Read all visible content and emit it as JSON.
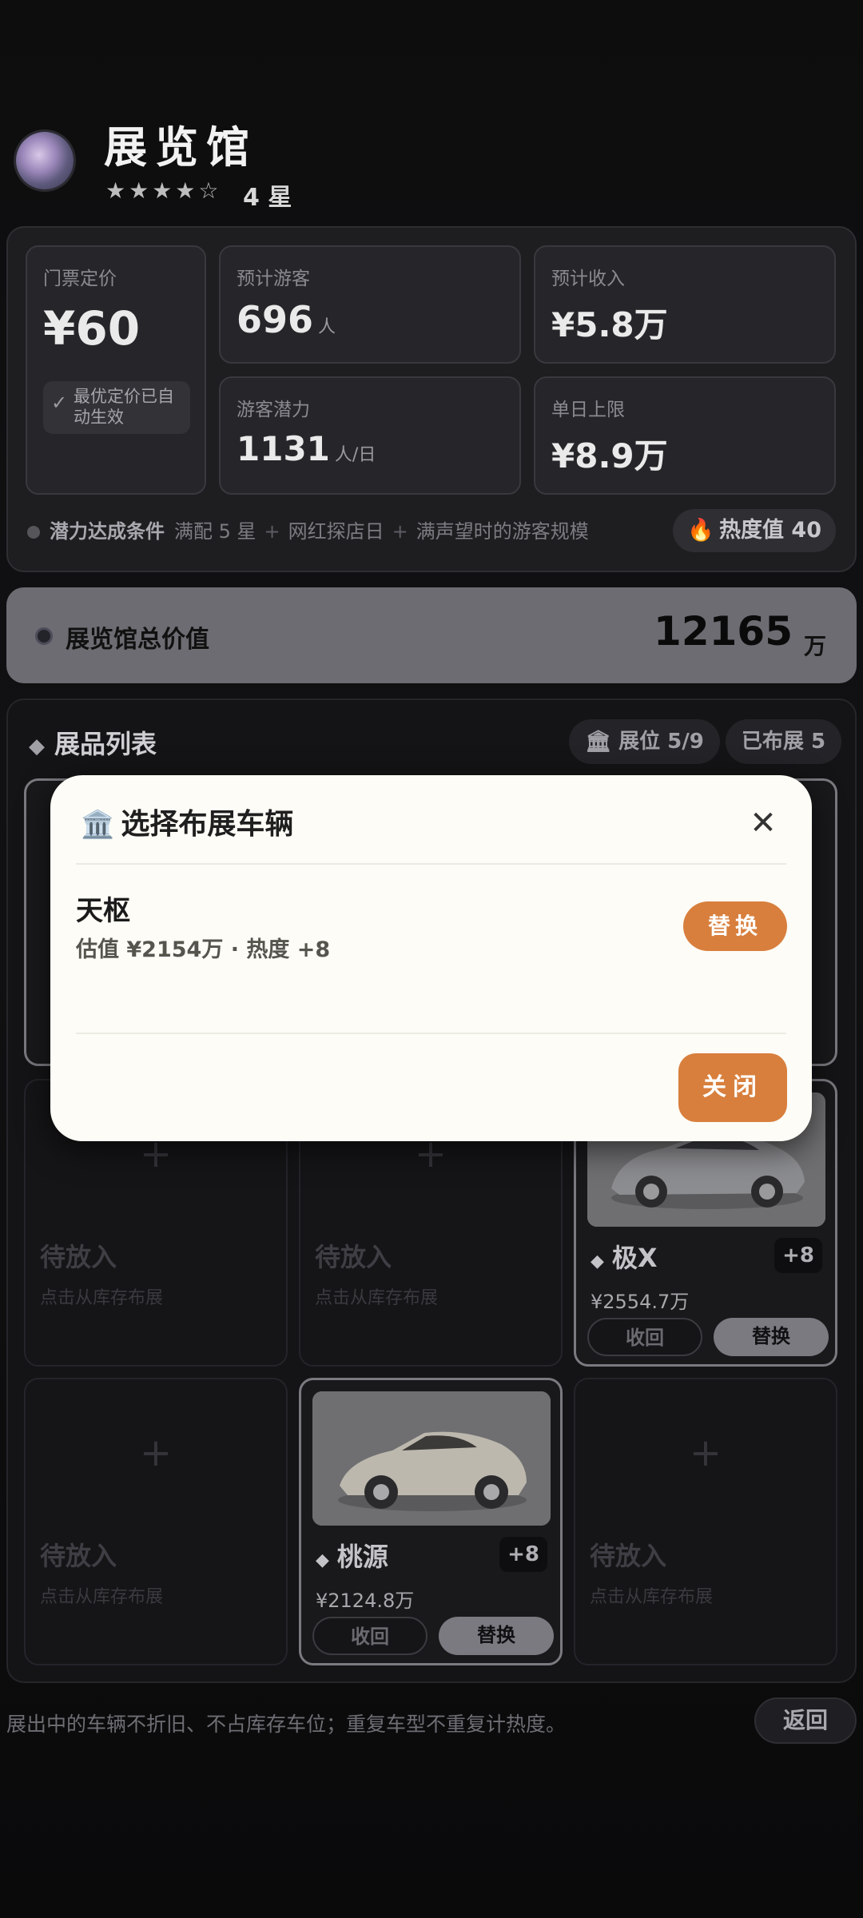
{
  "header": {
    "title": "展览馆",
    "stars_display": "★★★★☆",
    "star_text": "4 星"
  },
  "stats": {
    "ticket_price": {
      "label": "门票定价",
      "value": "¥60",
      "auto_note": "最优定价已自动生效"
    },
    "expected_visitors": {
      "label": "预计游客",
      "value": "696",
      "unit": "人"
    },
    "expected_income": {
      "label": "预计收入",
      "value": "¥5.8万"
    },
    "visitor_potential": {
      "label": "游客潜力",
      "value": "1131",
      "unit": "人/日"
    },
    "daily_cap": {
      "label": "单日上限",
      "value": "¥8.9万"
    },
    "condition": {
      "label": "潜力达成条件",
      "items": [
        "满配 5 星",
        "网红探店日",
        "满声望时的游客规模"
      ]
    },
    "heat": {
      "label": "热度值 40"
    }
  },
  "total_value": {
    "label": "展览馆总价值",
    "value": "12165",
    "unit": "万"
  },
  "exhibit_list": {
    "title": "展品列表",
    "slots_pill": "展位 5/9",
    "deployed_pill": "已布展 5",
    "empty_label": "待放入",
    "empty_hint": "点击从库存布展",
    "cars": [
      {
        "name": "极X",
        "badge": "+8",
        "price": "¥2554.7万",
        "recall": "收回",
        "swap": "替换"
      },
      {
        "name": "桃源",
        "badge": "+8",
        "price": "¥2124.8万",
        "recall": "收回",
        "swap": "替换"
      }
    ]
  },
  "footer": {
    "note": "展出中的车辆不折旧、不占库存车位；重复车型不重复计热度。",
    "back": "返回"
  },
  "modal": {
    "title": "选择布展车辆",
    "car_name": "天枢",
    "car_meta": "估值 ¥2154万 · 热度 +8",
    "swap": "替换",
    "close": "关闭"
  }
}
